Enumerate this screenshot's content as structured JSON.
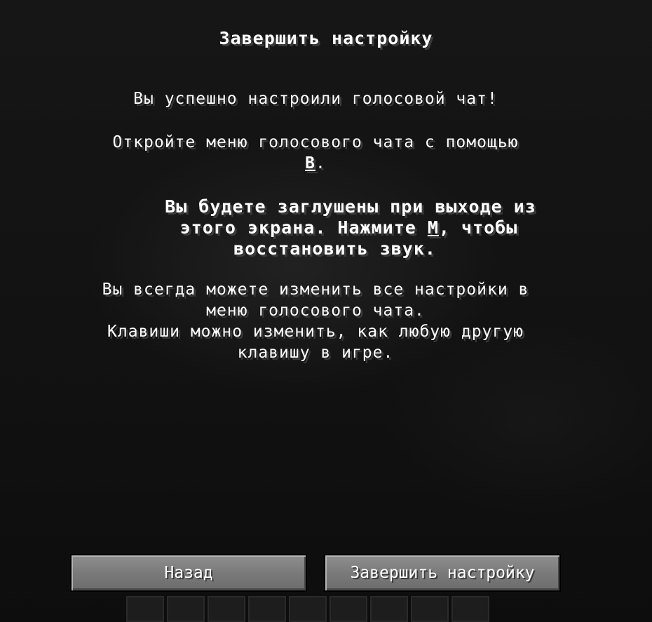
{
  "screen": {
    "title": "Завершить настройку",
    "success_message": "Вы успешно настроили голосовой чат!",
    "open_menu_line1": "Откройте меню голосового чата с помощью",
    "open_menu_key": "B",
    "open_menu_end": ".",
    "mute_line1": "Вы будете заглушены при выходе из",
    "mute_line2_pre": "этого экрана. Нажмите ",
    "mute_key": "M",
    "mute_line2_post": ", чтобы",
    "mute_line3": "восстановить звук.",
    "settings_line1": "Вы всегда можете изменить все настройки в",
    "settings_line2": "меню голосового чата.",
    "keys_line1": "Клавиши можно изменить, как любую другую",
    "keys_line2": "клавишу в игре."
  },
  "buttons": {
    "back_label": "Назад",
    "finish_label": "Завершить настройку"
  },
  "hotbar": {
    "slot_count": 9
  }
}
